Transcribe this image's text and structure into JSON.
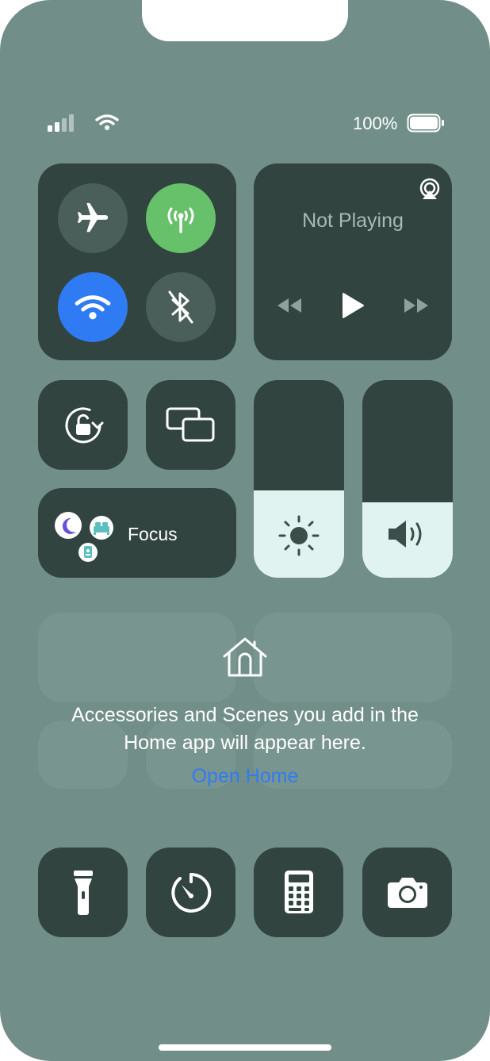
{
  "status_bar": {
    "battery_percent": "100%",
    "battery_level": 1.0,
    "cellular_bars": 2
  },
  "connectivity": {
    "airplane_mode": false,
    "cellular_data": true,
    "wifi": true,
    "bluetooth": false
  },
  "media": {
    "title": "Not Playing"
  },
  "focus": {
    "label": "Focus"
  },
  "sliders": {
    "brightness_level": 0.44,
    "volume_level": 0.38
  },
  "home": {
    "message_line1": "Accessories and Scenes you add in the",
    "message_line2": "Home app will appear here.",
    "link": "Open Home"
  },
  "colors": {
    "background": "#718f88",
    "tile": "#31443f",
    "cellular_active": "#66c16a",
    "wifi_active": "#2f7bf3",
    "slider_fill": "#e1f3f0",
    "link": "#2f7bf3"
  },
  "icons": [
    "airplane-icon",
    "cellular-icon",
    "wifi-icon",
    "bluetooth-icon",
    "airplay-icon",
    "rewind-icon",
    "play-icon",
    "fast-forward-icon",
    "orientation-lock-icon",
    "screen-mirroring-icon",
    "moon-icon",
    "bed-icon",
    "badge-icon",
    "brightness-icon",
    "volume-icon",
    "home-icon",
    "flashlight-icon",
    "timer-icon",
    "calculator-icon",
    "camera-icon"
  ]
}
